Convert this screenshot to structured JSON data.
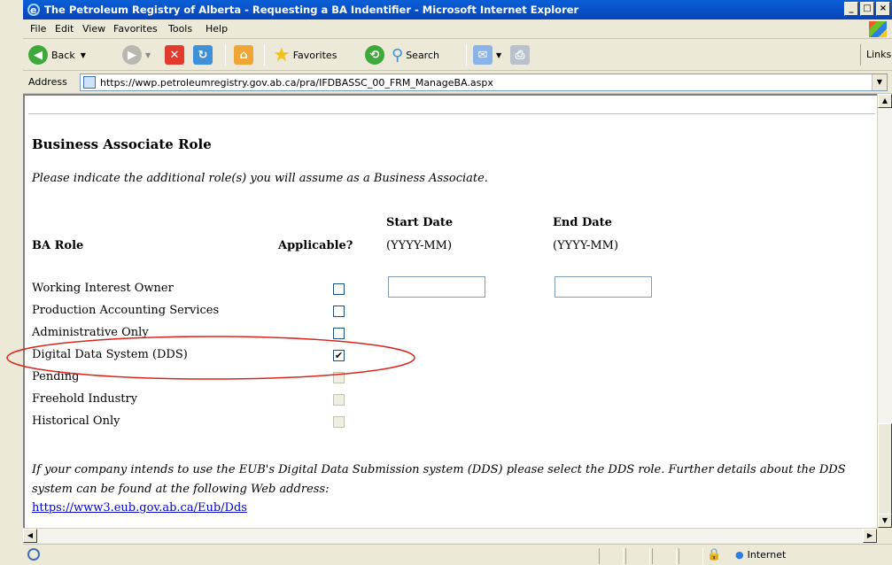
{
  "window": {
    "title": "The Petroleum Registry of Alberta - Requesting a BA Indentifier - Microsoft Internet Explorer",
    "minimize": "_",
    "maximize": "□",
    "close": "×"
  },
  "menu": {
    "file": "File",
    "edit": "Edit",
    "view": "View",
    "favorites": "Favorites",
    "tools": "Tools",
    "help": "Help"
  },
  "toolbar": {
    "back": "Back",
    "favorites": "Favorites",
    "search": "Search",
    "links": "Links"
  },
  "address": {
    "label": "Address",
    "url": "https://wwp.petroleumregistry.gov.ab.ca/pra/IFDBASSC_00_FRM_ManageBA.aspx"
  },
  "page": {
    "heading": "Business Associate Role",
    "intro": "Please indicate the additional role(s) you will assume as a Business Associate.",
    "col_role": "BA Role",
    "col_applicable": "Applicable?",
    "col_start": "Start Date",
    "col_start_fmt": "(YYYY-MM)",
    "col_end": "End Date",
    "col_end_fmt": "(YYYY-MM)",
    "roles": [
      {
        "label": "Working Interest Owner",
        "checked": false,
        "enabled": true
      },
      {
        "label": "Production Accounting Services",
        "checked": false,
        "enabled": true
      },
      {
        "label": "Administrative Only",
        "checked": false,
        "enabled": true
      },
      {
        "label": "Digital Data System (DDS)",
        "checked": true,
        "enabled": true
      },
      {
        "label": "Pending",
        "checked": false,
        "enabled": false
      },
      {
        "label": "Freehold Industry",
        "checked": false,
        "enabled": false
      },
      {
        "label": "Historical Only",
        "checked": false,
        "enabled": false
      }
    ],
    "footer_text": "If your company intends to use the EUB's Digital Data Submission system (DDS) please select the DDS role. Further details about the DDS system can be found at the following Web address:",
    "link": "https://www3.eub.gov.ab.ca/Eub/Dds",
    "check_mark": "✔"
  },
  "status": {
    "zone": "Internet"
  },
  "colors": {
    "highlight_ellipse": "#d9261c",
    "link": "#0000cc"
  }
}
